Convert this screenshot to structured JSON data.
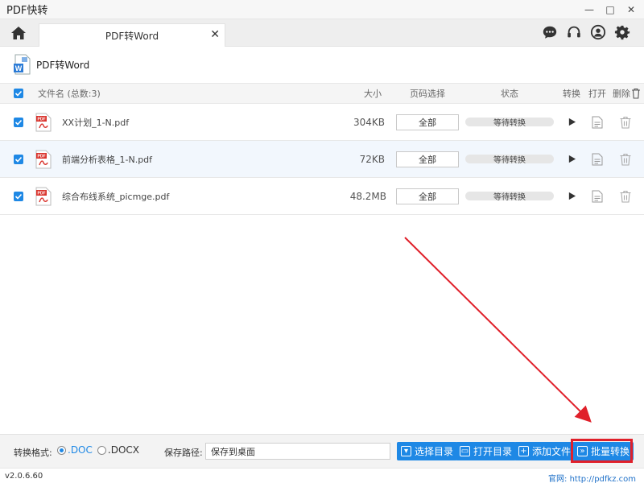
{
  "app": {
    "title": "PDF快转",
    "window_controls": {
      "minimize": "—",
      "maximize": "□",
      "close": "✕"
    }
  },
  "tabbar": {
    "home_icon": "home-icon",
    "tab_label": "PDF转Word",
    "tab_close": "✕",
    "right_icons": [
      "chat-icon",
      "headset-icon",
      "user-icon",
      "gear-icon"
    ]
  },
  "section": {
    "title": "PDF转Word",
    "icon": "word-file-icon"
  },
  "table": {
    "headers": {
      "filename": "文件名 (总数:3)",
      "size": "大小",
      "page_select": "页码选择",
      "status": "状态",
      "convert": "转换",
      "open": "打开",
      "delete": "删除"
    },
    "rows": [
      {
        "name": "XX计划_1-N.pdf",
        "size": "304KB",
        "pages": "全部",
        "status": "等待转换",
        "selected": false
      },
      {
        "name": "前端分析表格_1-N.pdf",
        "size": "72KB",
        "pages": "全部",
        "status": "等待转换",
        "selected": true
      },
      {
        "name": "综合布线系统_picmge.pdf",
        "size": "48.2MB",
        "pages": "全部",
        "status": "等待转换",
        "selected": false
      }
    ]
  },
  "bottom": {
    "format_label": "转换格式:",
    "format_options": [
      ".DOC",
      ".DOCX"
    ],
    "format_selected": ".DOC",
    "path_label": "保存路径:",
    "path_value": "保存到桌面",
    "buttons": {
      "select_dir": "选择目录",
      "open_dir": "打开目录",
      "add_file": "添加文件",
      "batch_convert": "批量转换"
    }
  },
  "statusbar": {
    "version": "v2.0.6.60",
    "site_label": "官网:",
    "site_url": "http://pdfkz.com"
  },
  "colors": {
    "accent": "#1e88e5",
    "highlight": "#e0202a",
    "pdf_red": "#d9322b"
  }
}
